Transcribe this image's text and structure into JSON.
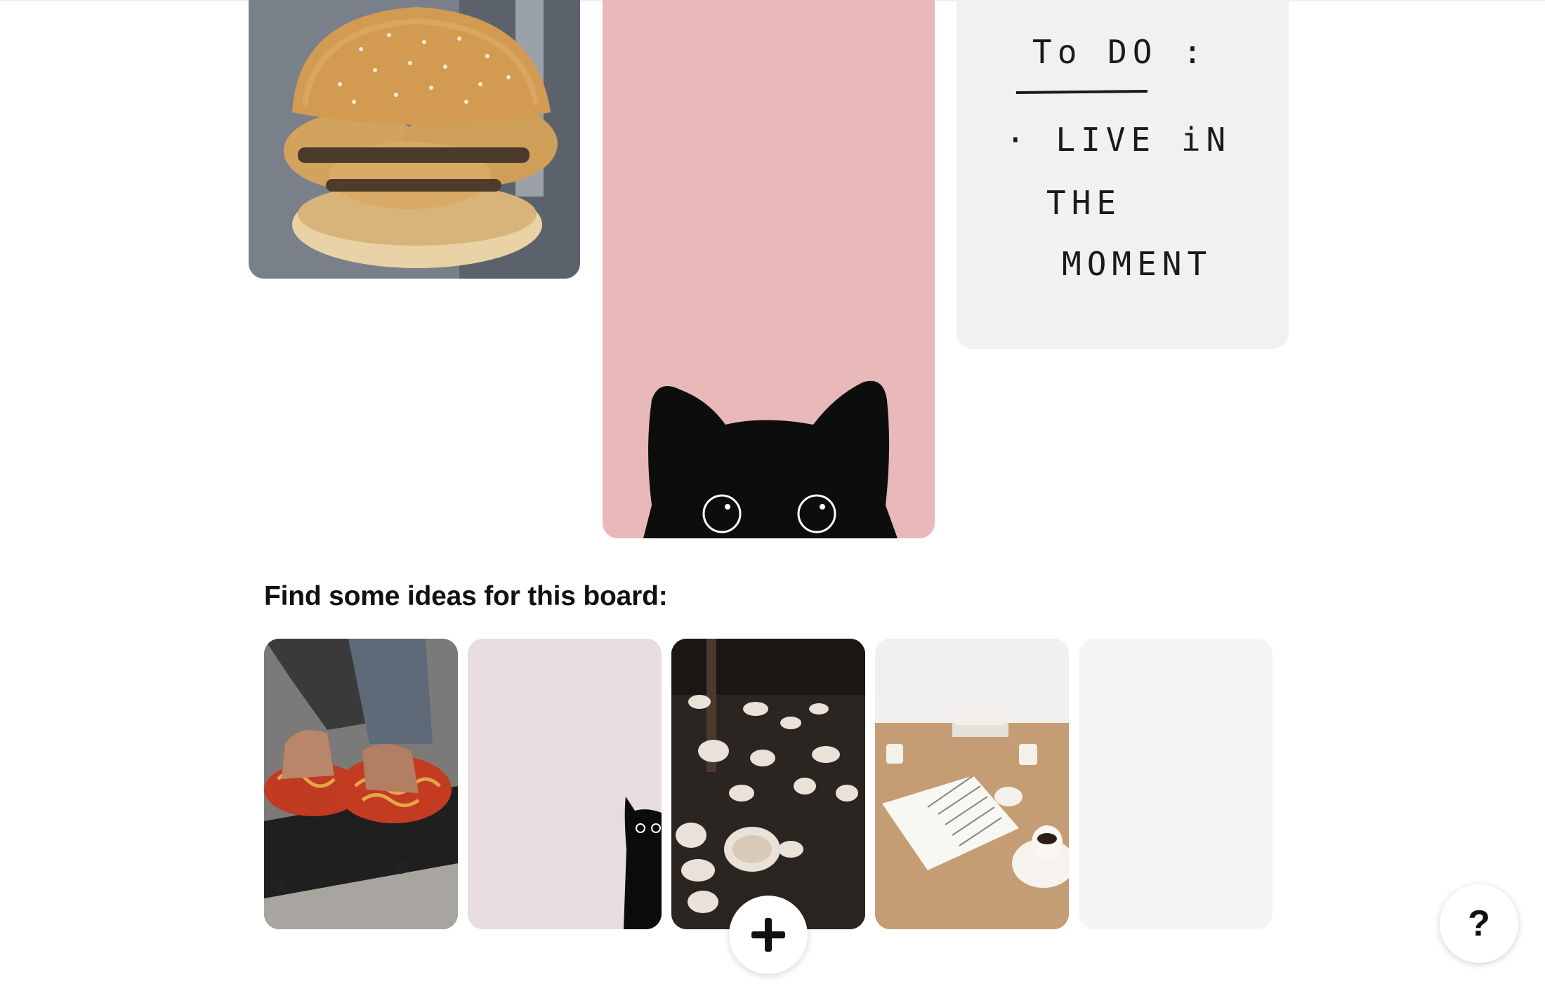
{
  "pins": [
    {
      "name": "burger-pin",
      "icon": "burger-image"
    },
    {
      "name": "cat-wallpaper-pin",
      "icon": "peeking-black-cat-image"
    },
    {
      "name": "todo-note-pin",
      "icon": "handwritten-note-image"
    }
  ],
  "todo_note": {
    "title": "To DO :",
    "lines": [
      "· LIVE iN",
      "THE",
      "MOMENT"
    ]
  },
  "ideas_section": {
    "heading": "Find some ideas for this board:"
  },
  "ideas": [
    {
      "name": "spaghetti-skateboard-idea",
      "icon": "spaghetti-feet-image"
    },
    {
      "name": "peeking-cat-idea",
      "icon": "cat-corner-image"
    },
    {
      "name": "teacup-legs-idea",
      "icon": "ceramic-teacups-image"
    },
    {
      "name": "desk-notebook-idea",
      "icon": "desk-notebook-image"
    },
    {
      "name": "loading-idea",
      "icon": "placeholder"
    }
  ],
  "buttons": {
    "add_icon": "plus-icon",
    "help_label": "?"
  },
  "colors": {
    "cat_background": "#e9b8b8",
    "note_background": "#f3f1ef",
    "text": "#111111"
  }
}
